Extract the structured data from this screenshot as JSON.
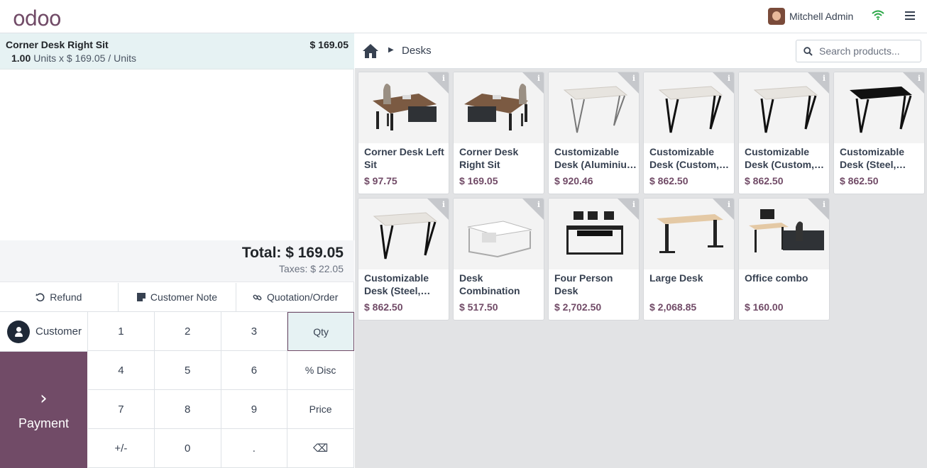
{
  "header": {
    "logo": "odoo",
    "user_name": "Mitchell Admin"
  },
  "order": {
    "line": {
      "product": "Corner Desk Right Sit",
      "price": "$ 169.05",
      "qty": "1.00",
      "unit_info": "Units x $ 169.05 / Units"
    },
    "total": "Total: $ 169.05",
    "taxes": "Taxes: $ 22.05"
  },
  "actions": {
    "refund": "Refund",
    "customer_note": "Customer Note",
    "quotation": "Quotation/Order"
  },
  "pad": {
    "customer": "Customer",
    "payment": "Payment",
    "keys": [
      "1",
      "2",
      "3",
      "Qty",
      "4",
      "5",
      "6",
      "% Disc",
      "7",
      "8",
      "9",
      "Price",
      "+/-",
      "0",
      ".",
      "⌫"
    ],
    "active_mode": "Qty"
  },
  "catalog": {
    "breadcrumb": "Desks",
    "search_placeholder": "Search products...",
    "products": [
      {
        "name": "Corner Desk Left Sit",
        "price": "$ 97.75",
        "icon": "corner-desk-image"
      },
      {
        "name": "Corner Desk Right Sit",
        "price": "$ 169.05",
        "icon": "corner-desk-image"
      },
      {
        "name": "Customizable Desk (Aluminiu…",
        "price": "$ 920.46",
        "icon": "white-desk-image"
      },
      {
        "name": "Customizable Desk (Custom,…",
        "price": "$ 862.50",
        "icon": "white-desk-image"
      },
      {
        "name": "Customizable Desk (Custom,…",
        "price": "$ 862.50",
        "icon": "white-desk-image"
      },
      {
        "name": "Customizable Desk (Steel,…",
        "price": "$ 862.50",
        "icon": "black-desk-image"
      },
      {
        "name": "Customizable Desk (Steel,…",
        "price": "$ 862.50",
        "icon": "white-desk-image"
      },
      {
        "name": "Desk Combination",
        "price": "$ 517.50",
        "icon": "desk-combination-image"
      },
      {
        "name": "Four Person Desk",
        "price": "$ 2,702.50",
        "icon": "four-person-desk-image"
      },
      {
        "name": "Large Desk",
        "price": "$ 2,068.85",
        "icon": "large-desk-image"
      },
      {
        "name": "Office combo",
        "price": "$ 160.00",
        "icon": "office-combo-image"
      }
    ]
  },
  "colors": {
    "brand": "#714b67",
    "selected_line": "#e6f2f3",
    "wifi": "#28a745"
  }
}
